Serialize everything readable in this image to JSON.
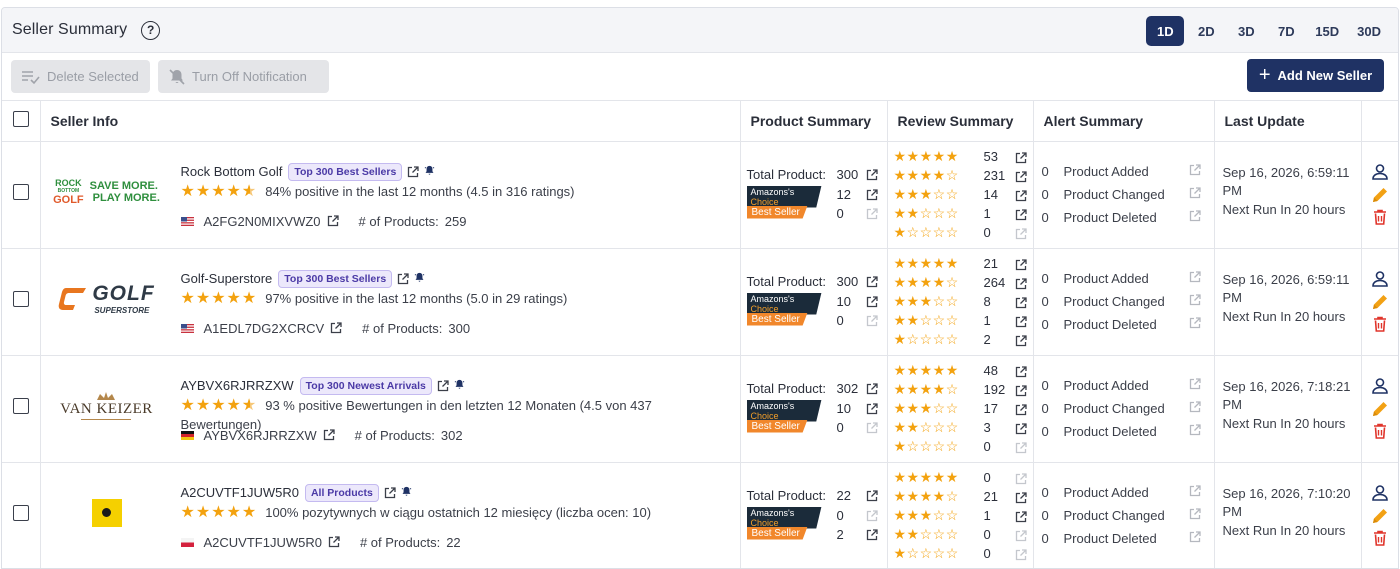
{
  "header": {
    "title": "Seller Summary",
    "periods": [
      "1D",
      "2D",
      "3D",
      "7D",
      "15D",
      "30D"
    ],
    "active_period": "1D"
  },
  "toolbar": {
    "delete_label": "Delete Selected",
    "notify_label": "Turn Off Notification",
    "add_label": "Add New Seller"
  },
  "columns": {
    "seller_info": "Seller Info",
    "product_summary": "Product Summary",
    "review_summary": "Review Summary",
    "alert_summary": "Alert Summary",
    "last_update": "Last Update"
  },
  "labels": {
    "total_product": "Total Product:",
    "amazons_choice_a": "Amazons's ",
    "amazons_choice_b": "Choice",
    "best_seller": "Best Seller",
    "product_added": "Product Added",
    "product_changed": "Product Changed",
    "product_deleted": "Product Deleted",
    "products_prefix": "# of Products:"
  },
  "colors": {
    "primary": "#1f3264",
    "star": "#f3a20f",
    "badge_bg": "#ece8fb",
    "badge_text": "#4b3aa6",
    "delete_red": "#e0352b",
    "edit_orange": "#f2a114"
  },
  "rows": [
    {
      "name": "Rock Bottom Golf",
      "badge": "Top 300 Best Sellers",
      "stars": 4.5,
      "rating_text": "84% positive in the last 12 months (4.5 in 316 ratings)",
      "country_flag": "US",
      "seller_id": "A2FG2N0MIXVWZ0",
      "products_count": "259",
      "logo": "rock-bottom-golf-logo",
      "total_product": "300",
      "amazons_choice": "12",
      "best_seller": "0",
      "reviews": [
        "53",
        "231",
        "14",
        "1",
        "0"
      ],
      "alerts": {
        "added": "0",
        "changed": "0",
        "deleted": "0"
      },
      "last_update_date": "Sep 16, 2026, 6:59:11",
      "last_update_ampm": "PM",
      "next_run": "Next Run In 20 hours"
    },
    {
      "name": "Golf-Superstore",
      "badge": "Top 300 Best Sellers",
      "stars": 5,
      "rating_text": "97% positive in the last 12 months (5.0 in 29 ratings)",
      "country_flag": "US",
      "seller_id": "A1EDL7DG2XCRCV",
      "products_count": "300",
      "logo": "golf-superstore-logo",
      "total_product": "300",
      "amazons_choice": "10",
      "best_seller": "0",
      "reviews": [
        "21",
        "264",
        "8",
        "1",
        "2"
      ],
      "alerts": {
        "added": "0",
        "changed": "0",
        "deleted": "0"
      },
      "last_update_date": "Sep 16, 2026, 6:59:11",
      "last_update_ampm": "PM",
      "next_run": "Next Run In 20 hours"
    },
    {
      "name": "AYBVX6RJRRZXW",
      "badge": "Top 300 Newest Arrivals",
      "stars": 4.5,
      "rating_text": "93 % positive Bewertungen in den letzten 12 Monaten (4.5 von 437 Bewertungen)",
      "country_flag": "DE",
      "seller_id": "AYBVX6RJRRZXW",
      "products_count": "302",
      "logo": "van-keizer-logo",
      "total_product": "302",
      "amazons_choice": "10",
      "best_seller": "0",
      "reviews": [
        "48",
        "192",
        "17",
        "3",
        "0"
      ],
      "alerts": {
        "added": "0",
        "changed": "0",
        "deleted": "0"
      },
      "last_update_date": "Sep 16, 2026, 7:18:21",
      "last_update_ampm": "PM",
      "next_run": "Next Run In 20 hours"
    },
    {
      "name": "A2CUVTF1JUW5R0",
      "badge": "All Products",
      "stars": 5,
      "rating_text": "100% pozytywnych w ciągu ostatnich 12 miesięcy (liczba ocen: 10)",
      "country_flag": "PL",
      "seller_id": "A2CUVTF1JUW5R0",
      "products_count": "22",
      "logo": "yellow-square-logo",
      "total_product": "22",
      "amazons_choice": "0",
      "best_seller": "2",
      "reviews": [
        "0",
        "21",
        "1",
        "0",
        "0"
      ],
      "alerts": {
        "added": "0",
        "changed": "0",
        "deleted": "0"
      },
      "last_update_date": "Sep 16, 2026, 7:10:20",
      "last_update_ampm": "PM",
      "next_run": "Next Run In 20 hours"
    }
  ],
  "logos": {
    "rock_a": "ROCK",
    "rock_b": "BOTTOM",
    "rock_c": "GOLF",
    "rock_slogan_1": "SAVE MORE.",
    "rock_slogan_2": "PLAY MORE.",
    "golf_a": "GOLF",
    "golf_b": "SUPERSTORE",
    "van_keizer": "VAN KEIZER"
  }
}
